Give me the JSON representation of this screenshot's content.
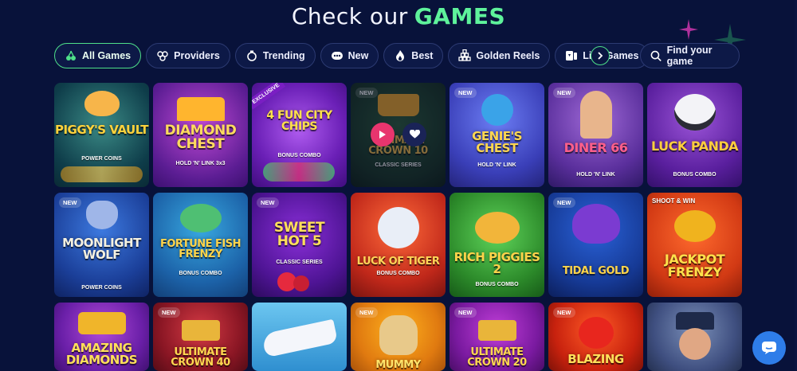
{
  "heading": {
    "lead": "Check our",
    "accent": "GAMES"
  },
  "filters": [
    {
      "label": "All Games",
      "icon": "cherries-icon",
      "active": true
    },
    {
      "label": "Providers",
      "icon": "providers-icon",
      "active": false
    },
    {
      "label": "Trending",
      "icon": "trending-icon",
      "active": false
    },
    {
      "label": "New",
      "icon": "new-icon",
      "active": false
    },
    {
      "label": "Best",
      "icon": "flame-icon",
      "active": false
    },
    {
      "label": "Golden Reels",
      "icon": "bars-icon",
      "active": false
    },
    {
      "label": "Live Games",
      "icon": "cards-icon",
      "active": false
    }
  ],
  "search": {
    "label": "Find your game"
  },
  "colors": {
    "accent": "#4ee089",
    "background": "#08123a",
    "play": "#e8356e",
    "chat": "#2e7de9"
  },
  "games": [
    {
      "title": "PIGGY'S VAULT",
      "subtitle": "POWER COINS",
      "badge": ""
    },
    {
      "title": "DIAMOND CHEST",
      "subtitle": "HOLD 'N' LINK 3x3",
      "badge": ""
    },
    {
      "title": "4 FUN CITY CHIPS",
      "subtitle": "BONUS COMBO",
      "badge": "EXCLUSIVE"
    },
    {
      "title": "ULTIMATE CROWN 10",
      "subtitle": "CLASSIC SERIES",
      "badge": "NEW"
    },
    {
      "title": "GENIE'S CHEST",
      "subtitle": "HOLD 'N' LINK",
      "badge": "NEW"
    },
    {
      "title": "DINER 66",
      "subtitle": "HOLD 'N' LINK",
      "badge": "NEW"
    },
    {
      "title": "LUCK PANDA",
      "subtitle": "BONUS COMBO",
      "badge": ""
    },
    {
      "title": "MOONLIGHT WOLF",
      "subtitle": "POWER COINS",
      "badge": "NEW"
    },
    {
      "title": "FORTUNE FISH FRENZY",
      "subtitle": "BONUS COMBO",
      "badge": ""
    },
    {
      "title": "SWEET HOT 5",
      "subtitle": "CLASSIC SERIES",
      "badge": "NEW"
    },
    {
      "title": "LUCK OF TIGER",
      "subtitle": "BONUS COMBO",
      "badge": ""
    },
    {
      "title": "RICH PIGGIES 2",
      "subtitle": "BONUS COMBO",
      "badge": ""
    },
    {
      "title": "TIDAL GOLD",
      "subtitle": "",
      "badge": "NEW"
    },
    {
      "title": "JACKPOT FRENZY",
      "subtitle": "SHOOT & WIN",
      "badge": ""
    },
    {
      "title": "AMAZING DIAMONDS",
      "subtitle": "",
      "badge": ""
    },
    {
      "title": "ULTIMATE CROWN 40",
      "subtitle": "",
      "badge": "NEW"
    },
    {
      "title": "",
      "subtitle": "",
      "badge": ""
    },
    {
      "title": "MUMMY",
      "subtitle": "",
      "badge": "NEW"
    },
    {
      "title": "ULTIMATE CROWN 20",
      "subtitle": "",
      "badge": "NEW"
    },
    {
      "title": "BLAZING",
      "subtitle": "",
      "badge": "NEW"
    },
    {
      "title": "",
      "subtitle": "",
      "badge": ""
    }
  ]
}
